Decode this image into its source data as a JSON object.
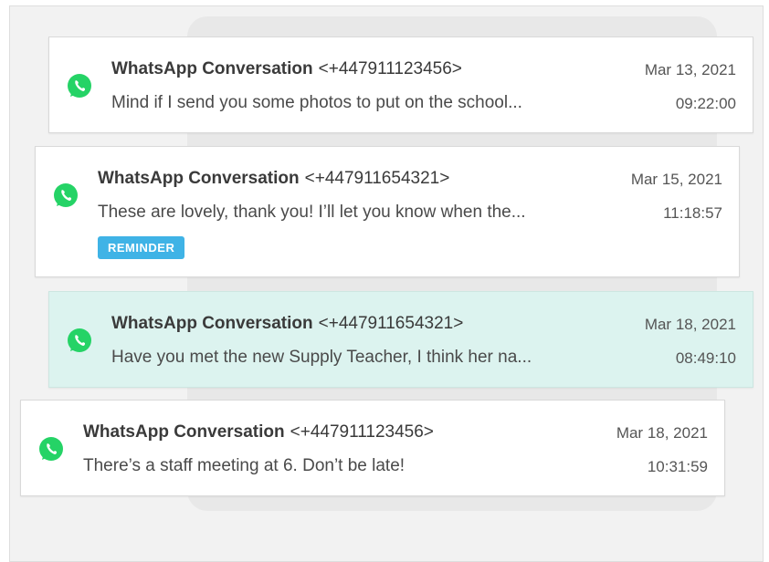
{
  "colors": {
    "whatsapp_green": "#25d366",
    "selected_bg": "#dcf3ef",
    "badge_blue": "#3fb3e6"
  },
  "conversations": [
    {
      "title": "WhatsApp Conversation",
      "number": "<+447911123456>",
      "preview": "Mind if I send you some photos to put on the school...",
      "date": "Mar 13, 2021",
      "time": "09:22:00",
      "icon": "whatsapp-icon",
      "selected": false
    },
    {
      "title": "WhatsApp Conversation",
      "number": "<+447911654321>",
      "preview": "These are lovely, thank you! I’ll let you know when the...",
      "date": "Mar 15, 2021",
      "time": "11:18:57",
      "icon": "whatsapp-icon",
      "badge": "REMINDER",
      "selected": false
    },
    {
      "title": "WhatsApp Conversation",
      "number": "<+447911654321>",
      "preview": "Have you met the new Supply Teacher, I think her na...",
      "date": "Mar 18, 2021",
      "time": "08:49:10",
      "icon": "whatsapp-icon",
      "selected": true
    },
    {
      "title": "WhatsApp Conversation",
      "number": "<+447911123456>",
      "preview": "There’s a staff meeting at 6. Don’t be late!",
      "date": "Mar 18, 2021",
      "time": "10:31:59",
      "icon": "whatsapp-icon",
      "selected": false
    }
  ]
}
